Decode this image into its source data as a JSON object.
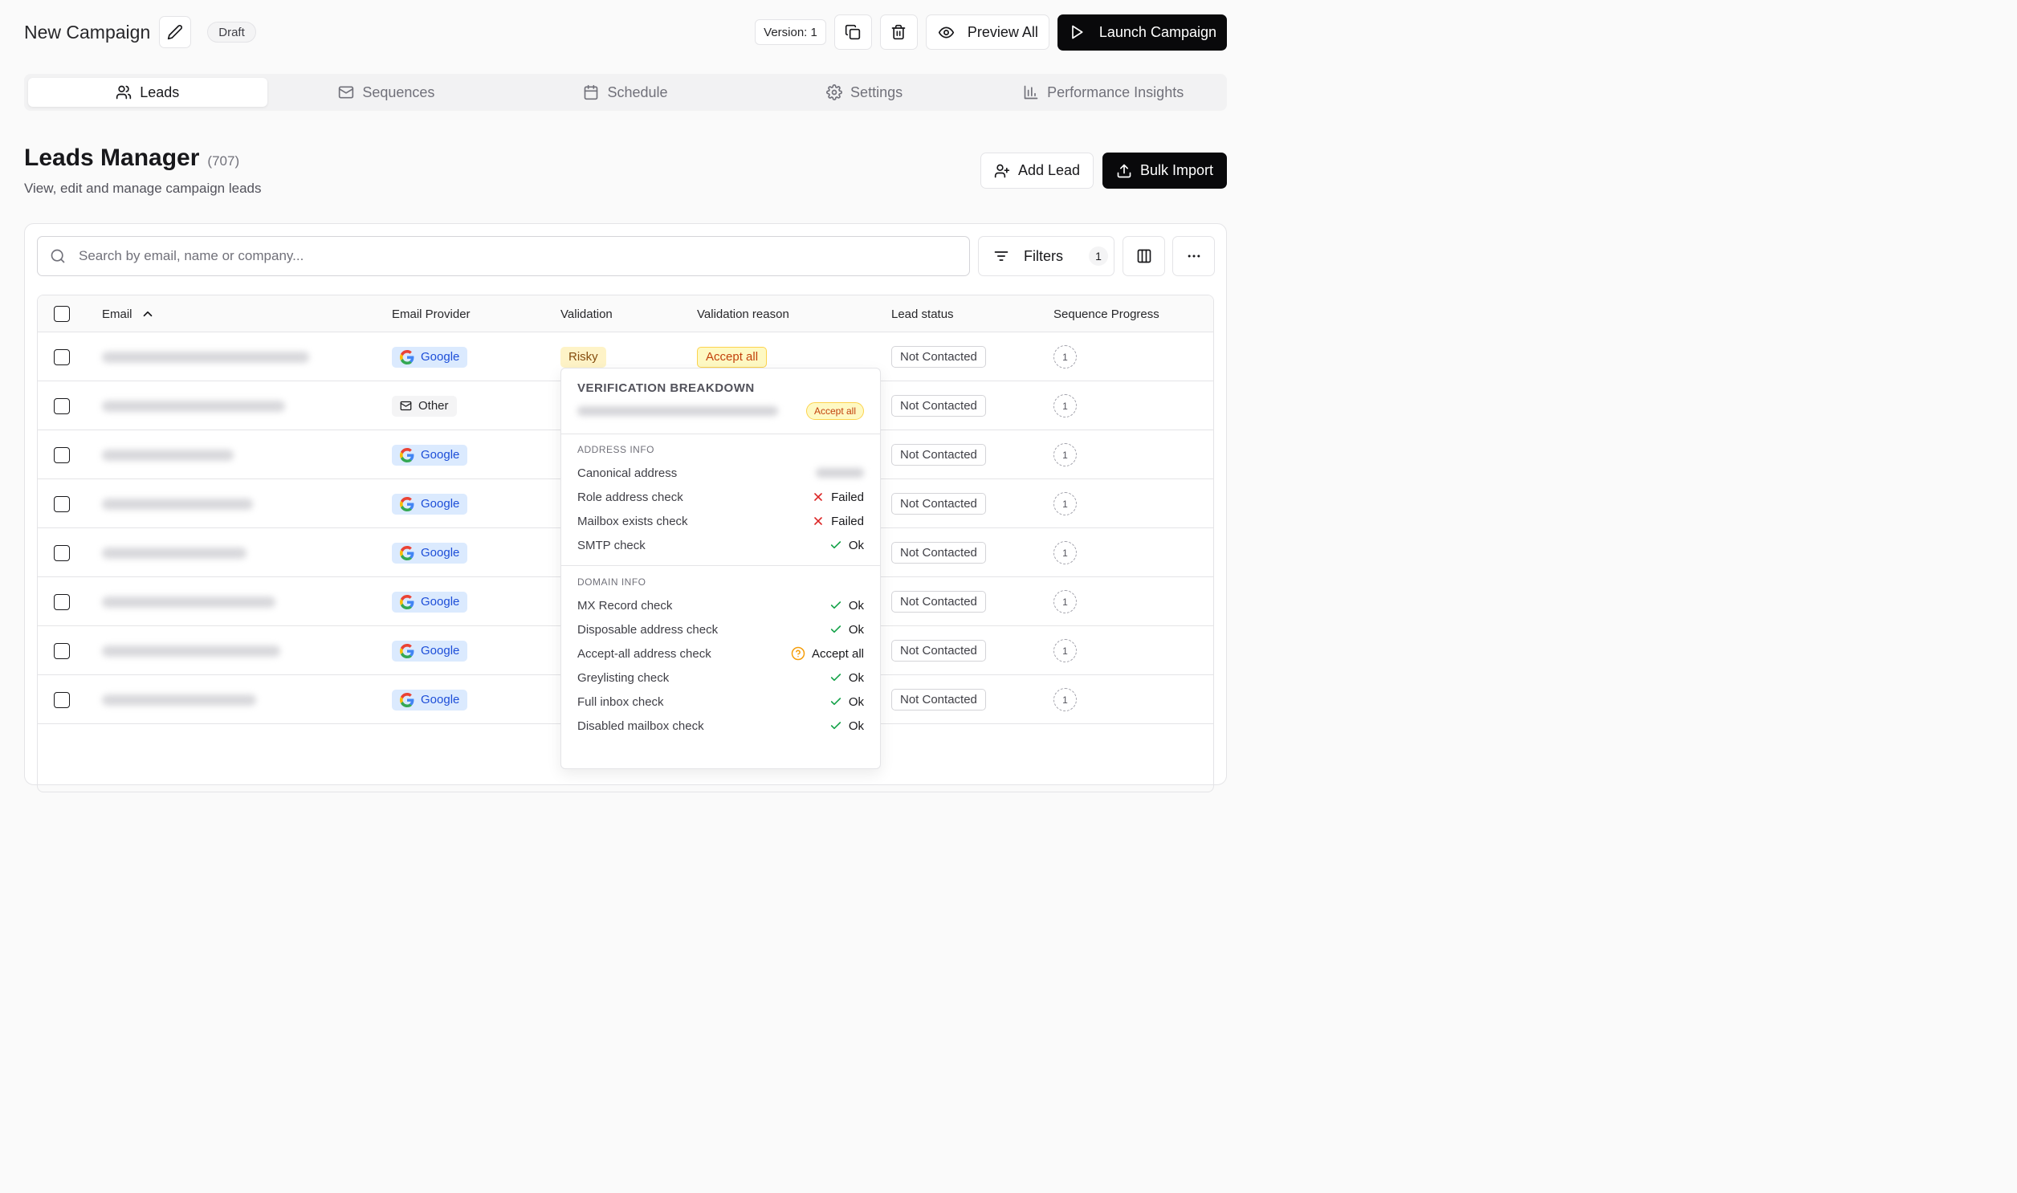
{
  "header": {
    "title": "New Campaign",
    "draft_badge": "Draft",
    "version": "Version: 1",
    "preview_label": "Preview All",
    "launch_label": "Launch Campaign"
  },
  "tabs": [
    {
      "label": "Leads",
      "active": true
    },
    {
      "label": "Sequences"
    },
    {
      "label": "Schedule"
    },
    {
      "label": "Settings"
    },
    {
      "label": "Performance Insights"
    }
  ],
  "section": {
    "title": "Leads Manager",
    "count": "(707)",
    "subtitle": "View, edit and manage campaign leads",
    "add_lead_label": "Add Lead",
    "bulk_import_label": "Bulk Import"
  },
  "search": {
    "placeholder": "Search by email, name or company..."
  },
  "filters": {
    "label": "Filters",
    "count": "1"
  },
  "table": {
    "columns": [
      "Email",
      "Email Provider",
      "Validation",
      "Validation reason",
      "Lead status",
      "Sequence Progress"
    ],
    "rows": [
      {
        "provider": "Google",
        "validation": "Risky",
        "reason": "Accept all",
        "status": "Not Contacted",
        "seq": "1"
      },
      {
        "provider": "Other",
        "status": "Not Contacted",
        "seq": "1"
      },
      {
        "provider": "Google",
        "status": "Not Contacted",
        "seq": "1"
      },
      {
        "provider": "Google",
        "status": "Not Contacted",
        "seq": "1"
      },
      {
        "provider": "Google",
        "status": "Not Contacted",
        "seq": "1"
      },
      {
        "provider": "Google",
        "status": "Not Contacted",
        "seq": "1"
      },
      {
        "provider": "Google",
        "status": "Not Contacted",
        "seq": "1"
      },
      {
        "provider": "Google",
        "status": "Not Contacted",
        "seq": "1"
      }
    ]
  },
  "breakdown": {
    "title": "VERIFICATION BREAKDOWN",
    "badge": "Accept all",
    "address_section": "ADDRESS INFO",
    "address_rows": [
      {
        "label": "Canonical address",
        "value": "",
        "kind": "blur"
      },
      {
        "label": "Role address check",
        "value": "Failed",
        "kind": "fail"
      },
      {
        "label": "Mailbox exists check",
        "value": "Failed",
        "kind": "fail"
      },
      {
        "label": "SMTP check",
        "value": "Ok",
        "kind": "ok"
      }
    ],
    "domain_section": "DOMAIN INFO",
    "domain_rows": [
      {
        "label": "MX Record check",
        "value": "Ok",
        "kind": "ok"
      },
      {
        "label": "Disposable address check",
        "value": "Ok",
        "kind": "ok"
      },
      {
        "label": "Accept-all address check",
        "value": "Accept all",
        "kind": "warn"
      },
      {
        "label": "Greylisting check",
        "value": "Ok",
        "kind": "ok"
      },
      {
        "label": "Full inbox check",
        "value": "Ok",
        "kind": "ok"
      },
      {
        "label": "Disabled mailbox check",
        "value": "Ok",
        "kind": "ok"
      }
    ]
  }
}
